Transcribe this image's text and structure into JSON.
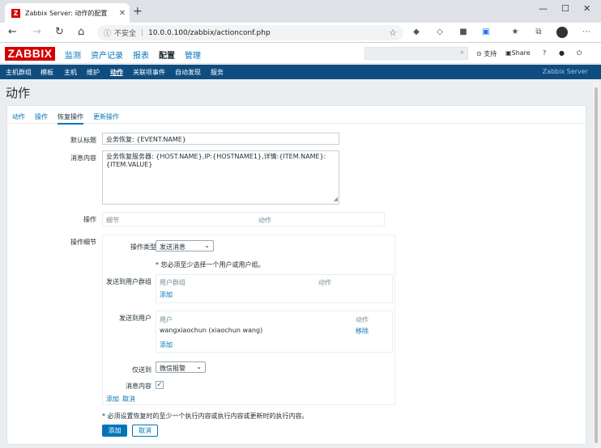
{
  "browser": {
    "tab_title": "Zabbix Server: 动作的配置",
    "tab_close": "✕",
    "new_tab": "+",
    "insecure": "不安全",
    "url": "10.0.0.100/zabbix/actionconf.php"
  },
  "zabbix": {
    "logo": "ZABBIX",
    "main_menu": [
      "监测",
      "资产记录",
      "报表",
      "配置",
      "管理"
    ],
    "active_main": "配置",
    "support": "支持",
    "share": "Share",
    "help": "?",
    "sub_menu": [
      "主机群组",
      "模板",
      "主机",
      "维护",
      "动作",
      "关联项事件",
      "自动发现",
      "服务"
    ],
    "active_sub": "动作",
    "server_name": "Zabbix Server"
  },
  "page": {
    "title": "动作",
    "tabs": [
      "动作",
      "操作",
      "恢复操作",
      "更新操作"
    ],
    "active_tab": "恢复操作"
  },
  "form": {
    "default_subject_label": "默认标题",
    "default_subject_value": "业务恢复: {EVENT.NAME}",
    "message_label": "消息内容",
    "message_value": "业务恢复服务器: {HOST.NAME},IP:{HOSTNAME1},详情:{ITEM.NAME}:{ITEM.VALUE}",
    "operations_label": "操作",
    "operations_col_details": "细节",
    "operations_col_action": "动作",
    "op_details_label": "操作细节",
    "op_type_label": "操作类型",
    "op_type_value": "发送消息",
    "op_warning": "* 您必须至少选择一个用户或用户组。",
    "send_to_groups_label": "发送到用户群组",
    "groups_col_group": "用户群组",
    "groups_col_action": "动作",
    "groups_add": "添加",
    "send_to_users_label": "发送到用户",
    "users_col_user": "用户",
    "users_col_action": "动作",
    "users": [
      {
        "name": "wangxiaochun (xiaochun wang)",
        "action": "移除"
      }
    ],
    "users_add": "添加",
    "send_only_label": "仅送到",
    "send_only_value": "微信报警",
    "message_content_label": "消息内容",
    "op_add": "添加",
    "op_cancel": "取消",
    "footer_warning": "* 必须设置恢复时的至少一个执行内容或执行内容或更新时的执行内容。",
    "submit_add": "添加",
    "submit_cancel": "取消"
  }
}
